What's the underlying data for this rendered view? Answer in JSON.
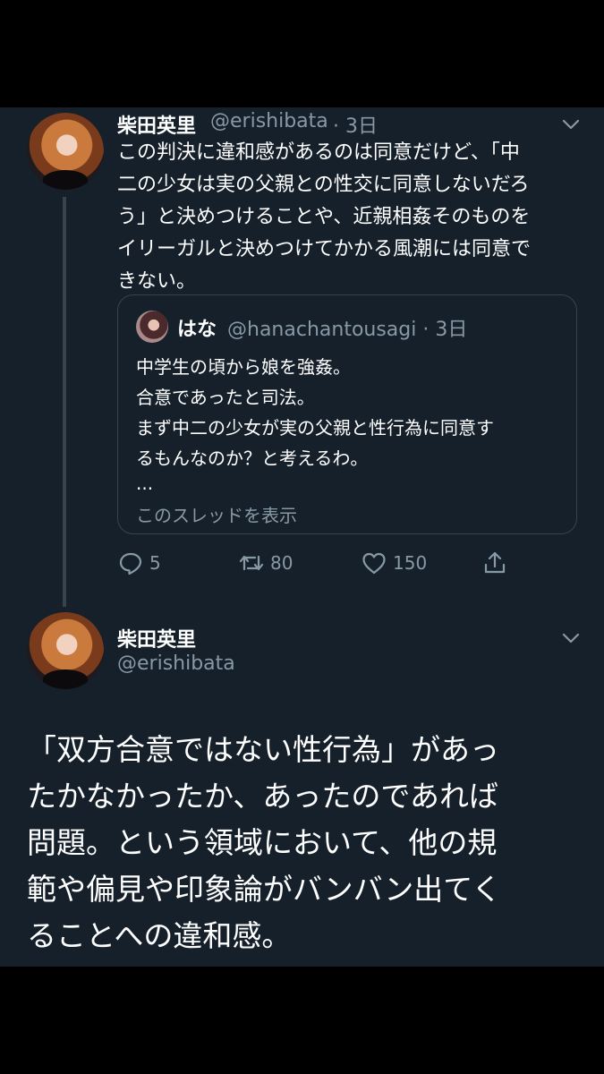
{
  "tweet1": {
    "display_name": "柴田英里",
    "handle": "@erishibata",
    "time": "· 3日",
    "text_lines": [
      "この判決に違和感があるのは同意だけど、「中",
      "二の少女は実の父親との性交に同意しないだろ",
      "う」と決めつけることや、近親相姦そのものを",
      "イリーガルと決めつけてかかる風潮には同意で",
      "きない。"
    ],
    "quote": {
      "display_name": "はな",
      "handle": "@hanachantousagi",
      "time": "· 3日",
      "text_lines": [
        "中学生の頃から娘を強姦。",
        "合意であったと司法。",
        "まず中二の少女が実の父親と性行為に同意す",
        "るもんなのか？と考えるわ。"
      ],
      "ellipsis": "...",
      "show_thread": "このスレッドを表示"
    },
    "actions": {
      "replies": "5",
      "retweets": "80",
      "likes": "150"
    }
  },
  "tweet2": {
    "display_name": "柴田英里",
    "handle": "@erishibata",
    "text_lines": [
      "「双方合意ではない性行為」があっ",
      "たかなかったか、あったのであれば",
      "問題。という領域において、他の規",
      "範や偏見や印象論がバンバン出てく",
      "ることへの違和感。"
    ]
  },
  "colors": {
    "background": "#15202b",
    "outer": "#000000",
    "text": "#ffffff",
    "secondary": "#8899a6",
    "border": "#38444d"
  },
  "icons": [
    "chevron-down-icon",
    "reply-icon",
    "retweet-icon",
    "like-icon",
    "share-icon"
  ]
}
